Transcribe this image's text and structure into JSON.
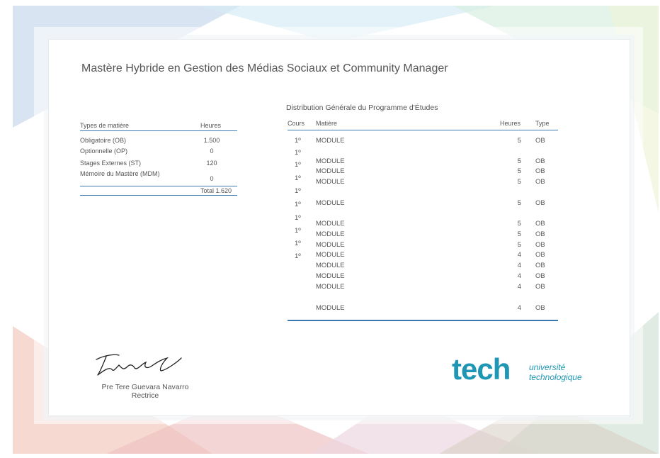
{
  "document": {
    "title": "Mastère Hybride en Gestion des Médias Sociaux et Community Manager"
  },
  "subject_table": {
    "headers": [
      "Types de matière",
      "Heures"
    ],
    "rows": [
      {
        "type": "Obligatoire (OB)",
        "hours": "1.500"
      },
      {
        "type": "Optionnelle (OP)",
        "hours": "0"
      },
      {
        "type": "Stages Externes (ST)",
        "hours": "120"
      },
      {
        "type": "Mémoire du Mastère (MDM)",
        "hours": "0"
      }
    ],
    "total": "Total 1.620"
  },
  "program": {
    "title": "Distribution Générale du Programme d'Études",
    "headers": [
      "Cours",
      "Matière",
      "Heures",
      "Type"
    ],
    "years": [
      "1º",
      "1º",
      "1º",
      "1º",
      "1º",
      "1º",
      "1º",
      "1º",
      "1º",
      "1º"
    ],
    "modules": [
      {
        "name": "MODULE",
        "hours": "5",
        "type": "OB"
      },
      {
        "name": "MODULE",
        "hours": "5",
        "type": "OB"
      },
      {
        "name": "MODULE",
        "hours": "5",
        "type": "OB"
      },
      {
        "name": "MODULE",
        "hours": "5",
        "type": "OB"
      },
      {
        "name": "MODULE",
        "hours": "5",
        "type": "OB"
      },
      {
        "name": "MODULE",
        "hours": "5",
        "type": "OB"
      },
      {
        "name": "MODULE",
        "hours": "5",
        "type": "OB"
      },
      {
        "name": "MODULE",
        "hours": "5",
        "type": "OB"
      },
      {
        "name": "MODULE",
        "hours": "4",
        "type": "OB"
      },
      {
        "name": "MODULE",
        "hours": "4",
        "type": "OB"
      },
      {
        "name": "MODULE",
        "hours": "4",
        "type": "OB"
      },
      {
        "name": "MODULE",
        "hours": "4",
        "type": "OB"
      },
      {
        "name": "MODULE",
        "hours": "4",
        "type": "OB"
      }
    ]
  },
  "signature": {
    "name": "Pre Tere Guevara Navarro",
    "role": "Rectrice"
  },
  "logo": {
    "wordmark": "tech",
    "line1": "université",
    "line2": "technologique",
    "color": "#1e96b4"
  }
}
